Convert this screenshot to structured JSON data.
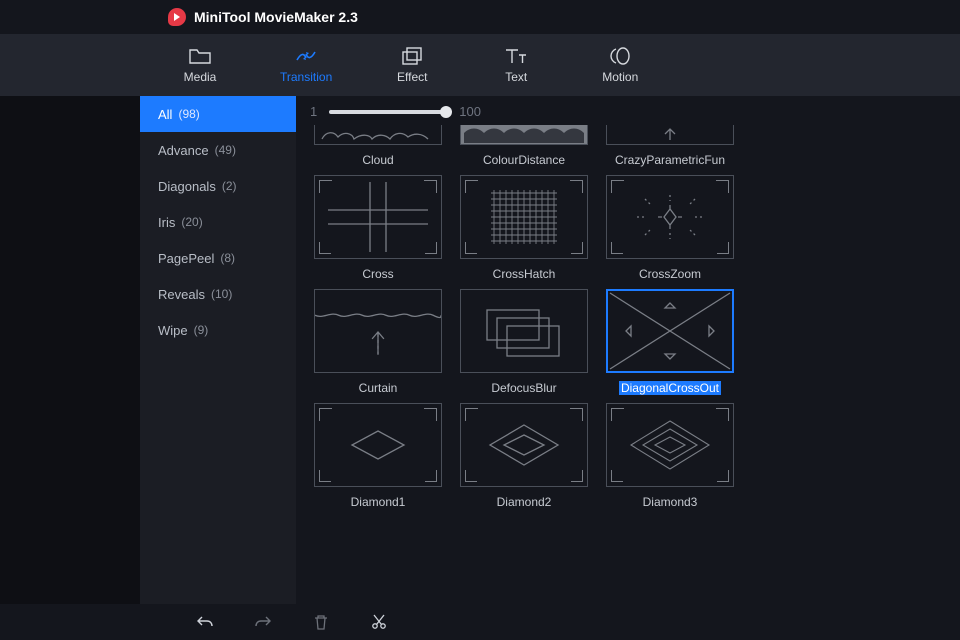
{
  "app": {
    "title": "MiniTool MovieMaker 2.3"
  },
  "toolbar": {
    "items": [
      {
        "label": "Media"
      },
      {
        "label": "Transition"
      },
      {
        "label": "Effect"
      },
      {
        "label": "Text"
      },
      {
        "label": "Motion"
      }
    ],
    "active_index": 1
  },
  "sidebar": {
    "items": [
      {
        "name": "All",
        "count": "(98)"
      },
      {
        "name": "Advance",
        "count": "(49)"
      },
      {
        "name": "Diagonals",
        "count": "(2)"
      },
      {
        "name": "Iris",
        "count": "(20)"
      },
      {
        "name": "PagePeel",
        "count": "(8)"
      },
      {
        "name": "Reveals",
        "count": "(10)"
      },
      {
        "name": "Wipe",
        "count": "(9)"
      }
    ],
    "active_index": 0
  },
  "zoom": {
    "min": "1",
    "max": "100"
  },
  "transitions": {
    "row0": [
      {
        "label": "Cloud"
      },
      {
        "label": "ColourDistance"
      },
      {
        "label": "CrazyParametricFun"
      }
    ],
    "row1": [
      {
        "label": "Cross"
      },
      {
        "label": "CrossHatch"
      },
      {
        "label": "CrossZoom"
      }
    ],
    "row2": [
      {
        "label": "Curtain"
      },
      {
        "label": "DefocusBlur"
      },
      {
        "label": "DiagonalCrossOut"
      }
    ],
    "row3": [
      {
        "label": "Diamond1"
      },
      {
        "label": "Diamond2"
      },
      {
        "label": "Diamond3"
      }
    ],
    "selected_label": "DiagonalCrossOut"
  },
  "footer_icons": [
    "undo-icon",
    "redo-icon",
    "trash-icon",
    "cut-icon"
  ]
}
